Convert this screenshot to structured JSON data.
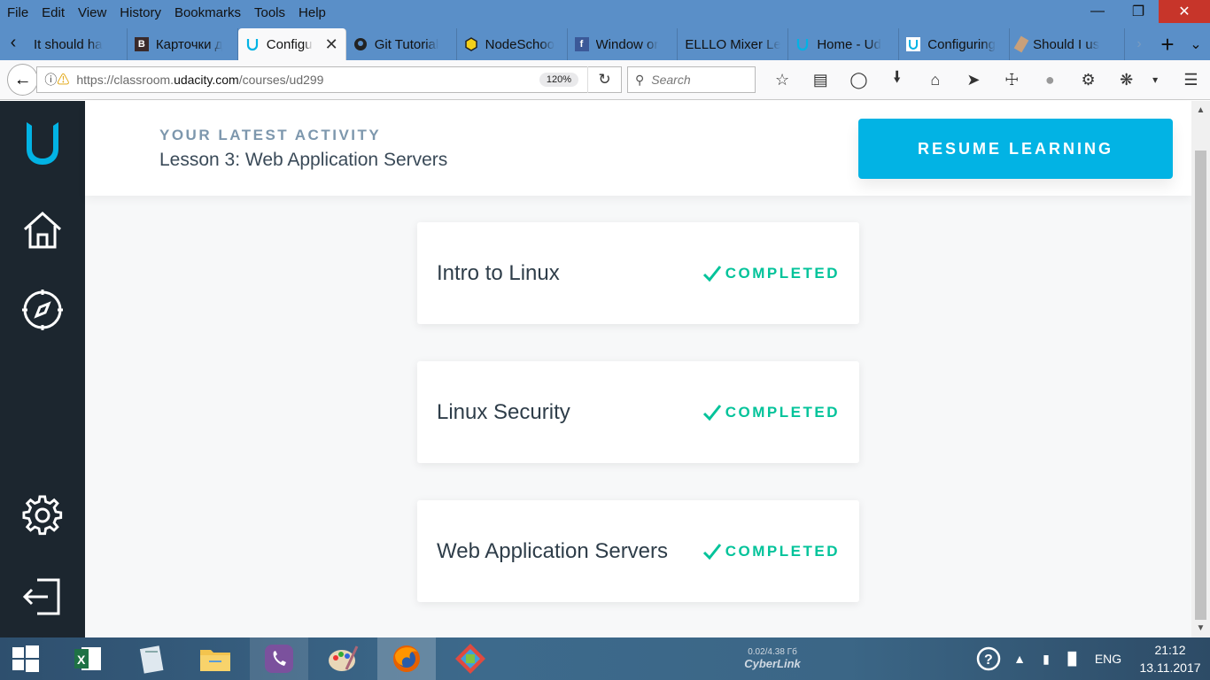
{
  "menu": [
    "File",
    "Edit",
    "View",
    "History",
    "Bookmarks",
    "Tools",
    "Help"
  ],
  "tabs": [
    {
      "title": "It should ha",
      "favicon": "none"
    },
    {
      "title": "Карточки д",
      "favicon": "B"
    },
    {
      "title": "Configu",
      "favicon": "udacity",
      "active": true
    },
    {
      "title": "Git Tutorial",
      "favicon": "github"
    },
    {
      "title": "NodeSchoo",
      "favicon": "node"
    },
    {
      "title": "Window or",
      "favicon": "facebook"
    },
    {
      "title": "ELLLO Mixer Le",
      "favicon": "none"
    },
    {
      "title": "Home - Ud",
      "favicon": "udacity"
    },
    {
      "title": "Configuring",
      "favicon": "udacity"
    },
    {
      "title": "Should I us",
      "favicon": "generic"
    }
  ],
  "navbar": {
    "url_prefix": "https://classroom.",
    "url_domain": "udacity.com",
    "url_path": "/courses/ud299",
    "zoom": "120%",
    "search_placeholder": "Search"
  },
  "header": {
    "activity_label": "YOUR LATEST ACTIVITY",
    "activity_title": "Lesson 3: Web Application Servers",
    "resume_label": "RESUME LEARNING"
  },
  "lessons": [
    {
      "title": "Intro to Linux",
      "status": "COMPLETED"
    },
    {
      "title": "Linux Security",
      "status": "COMPLETED"
    },
    {
      "title": "Web Application Servers",
      "status": "COMPLETED"
    }
  ],
  "taskbar": {
    "cyberlink_stat": "0.02/4.38 Гб",
    "cyberlink_brand": "CyberLink",
    "lang": "ENG",
    "time": "21:12",
    "date": "13.11.2017"
  },
  "colors": {
    "accent": "#02b3e4",
    "completed": "#02c39a",
    "sidenav": "#1c262f"
  }
}
